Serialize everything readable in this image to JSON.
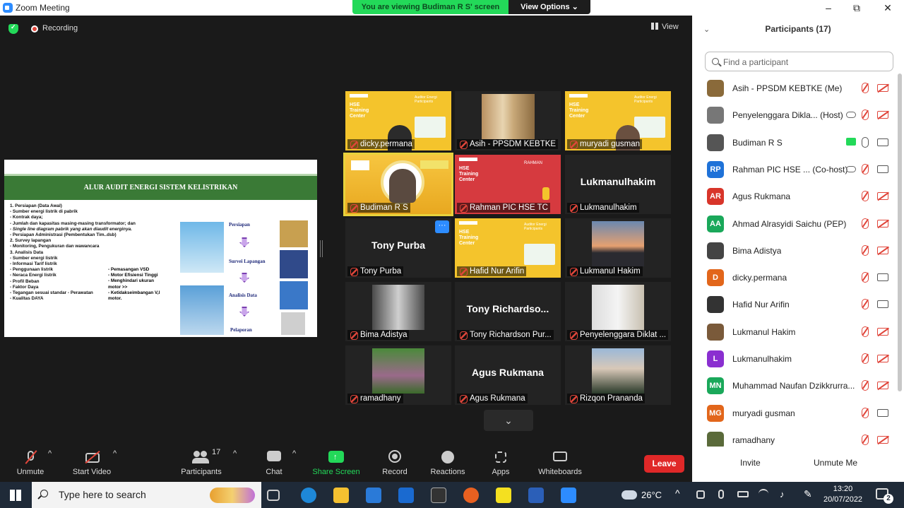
{
  "window": {
    "title": "Zoom Meeting",
    "minimize": "–",
    "restore": "⧉",
    "close": "✕"
  },
  "banner": {
    "viewing": "You are viewing Budiman R S' screen",
    "view_options": "View Options ⌄"
  },
  "meeting": {
    "recording": "Recording",
    "view": "View"
  },
  "slide": {
    "title": "ALUR AUDIT ENERGI SISTEM KELISTRIKAN",
    "items": [
      "1. Persiapan (Data Awal)",
      "-    Sumber energi listrik di pabrik",
      "-    Kontrak daya;",
      "-    Jumlah dan kapasitas masing-masing transformator; dan",
      "-    Single line diagram pabrik yang akan diaudit energinya.",
      "- Persiapan Administrasi (Pembentukan Tim..dsb)",
      "2. Survey lapangan",
      "-    Monitoring, Pengukuran dan wawancara",
      "3. Analisis Data",
      "-    Sumber energi listrik",
      "-    Informasi Tarif listrik",
      "-    Penggunaan listrik",
      "-    Neraca Energi listrik",
      "-    Profil Beban",
      "-    Faktor Daya",
      "-    Tegangan sesuai standar   - Perawatan",
      "-    Kualitas DAYA"
    ],
    "items_col2": [
      "- Pemasangan VSD",
      "- Motor Efisiensi Tinggi",
      "- Menghindari ukuran",
      "  motor >>",
      "- Ketidakseimbangan V,I",
      "  motor."
    ],
    "steps": [
      "Persiapan",
      "Survei Lapangan",
      "Analisis Data",
      "Pelaporan"
    ]
  },
  "tiles": [
    {
      "name": "dicky.permana",
      "big": "",
      "hse": "HSE Training Center"
    },
    {
      "name": "Asih - PPSDM KEBTKE",
      "big": ""
    },
    {
      "name": "muryadi gusman",
      "big": "",
      "hse": "HSE Training Center"
    },
    {
      "name": "Budiman R S",
      "big": ""
    },
    {
      "name": "Rahman PIC HSE TC",
      "big": "",
      "hse": "HSE Training Center",
      "tag": "RAHMAN"
    },
    {
      "name": "Lukmanulhakim",
      "big": "Lukmanulhakim"
    },
    {
      "name": "Tony Purba",
      "big": "Tony Purba"
    },
    {
      "name": "Hafid Nur Arifin",
      "big": "",
      "hse": "HSE Training Center"
    },
    {
      "name": "Lukmanul Hakim",
      "big": ""
    },
    {
      "name": "Bima Adistya",
      "big": ""
    },
    {
      "name": "Tony Richardson Pur...",
      "big": "Tony  Richardso..."
    },
    {
      "name": "Penyelenggara Diklat ...",
      "big": ""
    },
    {
      "name": "ramadhany",
      "big": ""
    },
    {
      "name": "Agus Rukmana",
      "big": "Agus Rukmana"
    },
    {
      "name": "Rizqon Prananda",
      "big": ""
    }
  ],
  "hse_aud": "Auditor Energi Participants",
  "more_btn": "···",
  "scroll_down": "⌄",
  "toolbar": {
    "unmute": "Unmute",
    "start_video": "Start Video",
    "participants": "Participants",
    "participants_count": "17",
    "chat": "Chat",
    "share": "Share Screen",
    "record": "Record",
    "reactions": "Reactions",
    "apps": "Apps",
    "whiteboards": "Whiteboards",
    "leave": "Leave"
  },
  "panel": {
    "title": "Participants (17)",
    "search_placeholder": "Find a participant",
    "invite": "Invite",
    "unmute_me": "Unmute Me",
    "participants": [
      {
        "name": "Asih - PPSDM KEBTKE (Me)",
        "initials": "",
        "color": "#8a6a3a",
        "mic": "off",
        "cam": "off"
      },
      {
        "name": "Penyelenggara Dikla... (Host)",
        "initials": "",
        "color": "#777777",
        "mic": "off",
        "cam": "off",
        "cloud": true
      },
      {
        "name": "Budiman R S",
        "initials": "",
        "color": "#555555",
        "mic": "on",
        "cam": "on",
        "share": true
      },
      {
        "name": "Rahman PIC HSE ... (Co-host)",
        "initials": "RP",
        "color": "#1f72d8",
        "mic": "off",
        "cam": "on",
        "cloud": true
      },
      {
        "name": "Agus Rukmana",
        "initials": "AR",
        "color": "#d8352a",
        "mic": "off",
        "cam": "off"
      },
      {
        "name": "Ahmad Alrasyidi Saichu (PEP)",
        "initials": "AA",
        "color": "#1aa85a",
        "mic": "off",
        "cam": "off"
      },
      {
        "name": "Bima Adistya",
        "initials": "",
        "color": "#444444",
        "mic": "off",
        "cam": "off"
      },
      {
        "name": "dicky.permana",
        "initials": "D",
        "color": "#e2661b",
        "mic": "off",
        "cam": "on"
      },
      {
        "name": "Hafid Nur Arifin",
        "initials": "",
        "color": "#333333",
        "mic": "off",
        "cam": "on"
      },
      {
        "name": "Lukmanul Hakim",
        "initials": "",
        "color": "#7a5a3a",
        "mic": "off",
        "cam": "off"
      },
      {
        "name": "Lukmanulhakim",
        "initials": "L",
        "color": "#8a2fd0",
        "mic": "off",
        "cam": "off"
      },
      {
        "name": "Muhammad Naufan Dzikkrurra...",
        "initials": "MN",
        "color": "#1aa85a",
        "mic": "off",
        "cam": "off"
      },
      {
        "name": "muryadi gusman",
        "initials": "MG",
        "color": "#e2661b",
        "mic": "off",
        "cam": "on"
      },
      {
        "name": "ramadhany",
        "initials": "",
        "color": "#5a6a3a",
        "mic": "off",
        "cam": "off"
      }
    ]
  },
  "taskbar": {
    "search": "Type here to search",
    "temp": "26°C",
    "time": "13:20",
    "date": "20/07/2022",
    "notif": "2"
  }
}
